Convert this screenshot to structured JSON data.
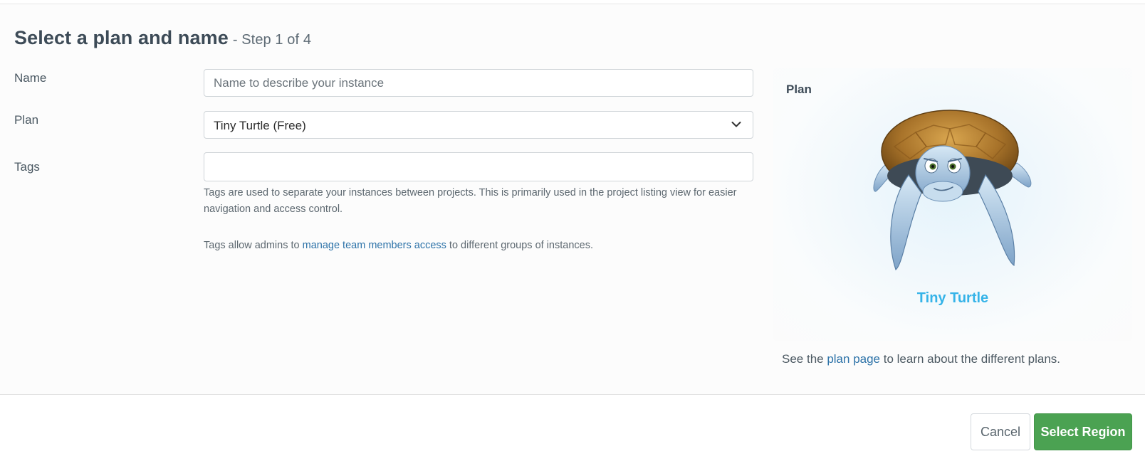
{
  "page": {
    "title": "Select a plan and name",
    "step": "- Step 1 of 4"
  },
  "form": {
    "name_label": "Name",
    "name_placeholder": "Name to describe your instance",
    "name_value": "",
    "plan_label": "Plan",
    "plan_selected": "Tiny Turtle (Free)",
    "tags_label": "Tags",
    "tags_value": "",
    "tags_help_1": "Tags are used to separate your instances between projects. This is primarily used in the project listing view for easier navigation and access control.",
    "tags_help_2_prefix": "Tags allow admins to ",
    "tags_help_2_link": "manage team members access",
    "tags_help_2_suffix": " to different groups of instances."
  },
  "plan_card": {
    "title": "Plan",
    "name": "Tiny Turtle",
    "mascot_icon": "turtle-mascot",
    "name_color": "#35b3e8"
  },
  "plan_note": {
    "prefix": "See the ",
    "link": "plan page",
    "suffix": " to learn about the different plans."
  },
  "buttons": {
    "cancel": "Cancel",
    "primary": "Select Region",
    "primary_color": "#4ba252"
  }
}
